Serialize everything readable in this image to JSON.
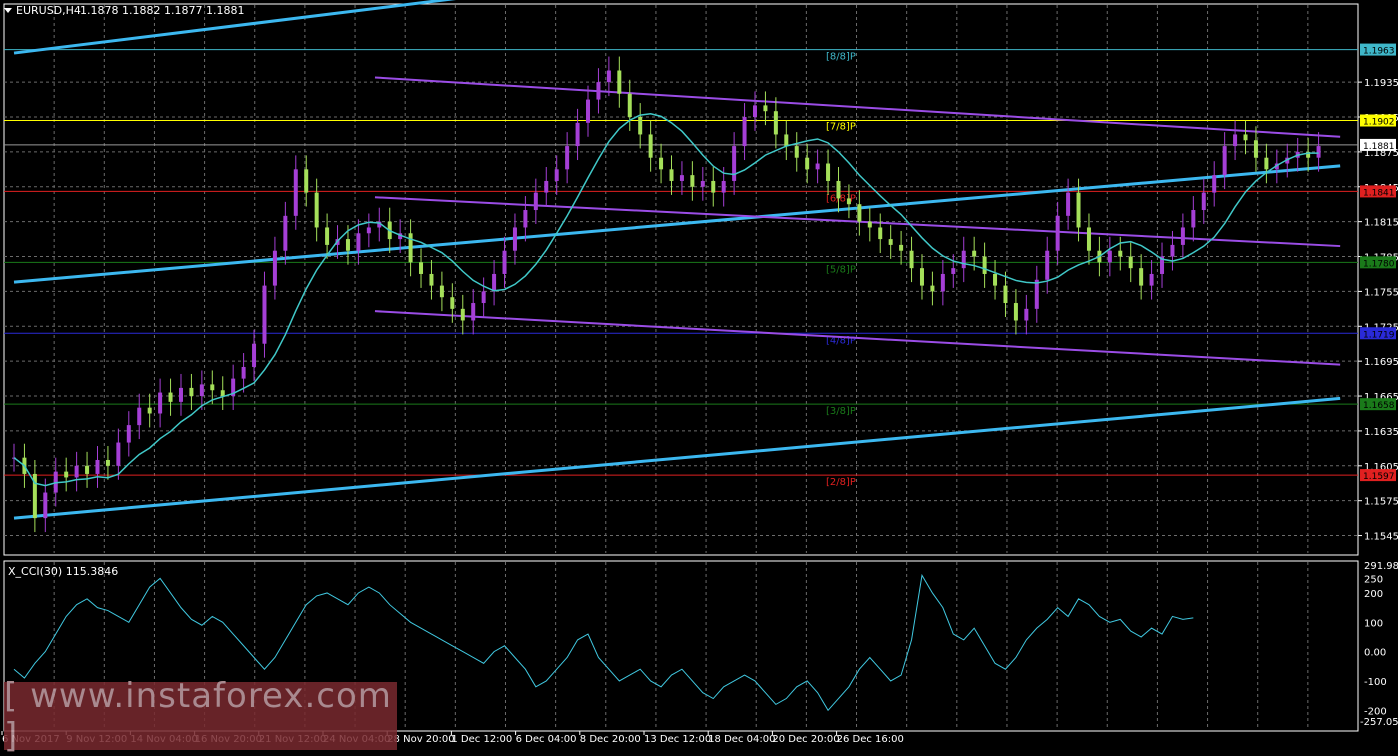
{
  "header": {
    "symbol": "EURUSD,H4",
    "ohlc": "1.1878 1.1882 1.1877 1.1881"
  },
  "indicator": {
    "label": "X_CCI(30) 115.3846",
    "max_label": "291.98",
    "min_label": "-257.052",
    "ticks": [
      "250",
      "200",
      "100",
      "0.00",
      "-100",
      "-200"
    ]
  },
  "watermark": "[ www.instaforex.com ]",
  "chart_data": {
    "type": "candlestick",
    "ylim": [
      1.153,
      1.1985
    ],
    "y_ticks": [
      1.1935,
      1.1905,
      1.1875,
      1.1845,
      1.1815,
      1.1785,
      1.1755,
      1.1725,
      1.1695,
      1.1665,
      1.1635,
      1.1605,
      1.1575,
      1.1545
    ],
    "x_tick_labels": [
      "6 Nov 2017",
      "9 Nov 12:00",
      "14 Nov 04:00",
      "16 Nov 20:00",
      "21 Nov 12:00",
      "24 Nov 04:00",
      "28 Nov 20:00",
      "1 Dec 12:00",
      "6 Dec 04:00",
      "8 Dec 20:00",
      "13 Dec 12:00",
      "18 Dec 04:00",
      "20 Dec 20:00",
      "26 Dec 16:00"
    ],
    "current_price": 1.1881,
    "murray_levels": [
      {
        "label": "[8/8]P",
        "price": 1.1963,
        "price_label": "1.1963",
        "color": "#3fb7c9"
      },
      {
        "label": "[7/8]P",
        "price": 1.1902,
        "price_label": "1.1902",
        "color": "#ffff00"
      },
      {
        "label": "[6/8]P",
        "price": 1.1841,
        "price_label": "1.1841",
        "color": "#e02020"
      },
      {
        "label": "[5/8]P",
        "price": 1.178,
        "price_label": "1.1780",
        "color": "#1a7a1a"
      },
      {
        "label": "[4/8]P",
        "price": 1.1719,
        "price_label": "1.1719",
        "color": "#2a2ad8"
      },
      {
        "label": "[3/8]P",
        "price": 1.1658,
        "price_label": "1.1658",
        "color": "#1a7a1a"
      },
      {
        "label": "[2/8]P",
        "price": 1.1597,
        "price_label": "1.1597",
        "color": "#e02020"
      }
    ],
    "candles": [
      1.1612,
      1.1598,
      1.156,
      1.1582,
      1.16,
      1.1595,
      1.1605,
      1.1598,
      1.161,
      1.1605,
      1.1625,
      1.164,
      1.1655,
      1.165,
      1.1668,
      1.166,
      1.1672,
      1.1665,
      1.1675,
      1.167,
      1.1665,
      1.168,
      1.169,
      1.171,
      1.176,
      1.179,
      1.182,
      1.186,
      1.184,
      1.181,
      1.1795,
      1.18,
      1.179,
      1.1805,
      1.181,
      1.1815,
      1.18,
      1.1805,
      1.178,
      1.177,
      1.176,
      1.175,
      1.174,
      1.173,
      1.1745,
      1.1755,
      1.177,
      1.179,
      1.181,
      1.1825,
      1.184,
      1.185,
      1.186,
      1.188,
      1.19,
      1.192,
      1.1935,
      1.1945,
      1.1925,
      1.1905,
      1.189,
      1.187,
      1.186,
      1.185,
      1.1855,
      1.1845,
      1.185,
      1.184,
      1.185,
      1.188,
      1.1905,
      1.1915,
      1.191,
      1.189,
      1.188,
      1.187,
      1.186,
      1.1865,
      1.185,
      1.1835,
      1.183,
      1.1815,
      1.181,
      1.18,
      1.1795,
      1.179,
      1.1775,
      1.176,
      1.1755,
      1.177,
      1.1775,
      1.179,
      1.1785,
      1.177,
      1.176,
      1.1745,
      1.173,
      1.174,
      1.1765,
      1.179,
      1.182,
      1.184,
      1.181,
      1.179,
      1.178,
      1.179,
      1.1785,
      1.1775,
      1.176,
      1.177,
      1.1785,
      1.1795,
      1.181,
      1.1825,
      1.184,
      1.1855,
      1.188,
      1.189,
      1.1885,
      1.187,
      1.186,
      1.1865,
      1.187,
      1.1875,
      1.187,
      1.188
    ],
    "series": [
      {
        "name": "",
        "type": "cci",
        "ylim": [
          -257.052,
          291.98
        ],
        "values": [
          -60,
          -90,
          -40,
          0,
          60,
          120,
          160,
          180,
          150,
          140,
          120,
          100,
          160,
          220,
          250,
          200,
          150,
          110,
          90,
          120,
          100,
          60,
          20,
          -20,
          -60,
          -20,
          40,
          100,
          160,
          190,
          200,
          180,
          160,
          200,
          220,
          200,
          160,
          130,
          100,
          80,
          60,
          40,
          20,
          0,
          -20,
          -40,
          0,
          20,
          -20,
          -60,
          -120,
          -100,
          -60,
          -20,
          40,
          60,
          -20,
          -60,
          -100,
          -80,
          -60,
          -100,
          -120,
          -80,
          -60,
          -100,
          -140,
          -160,
          -120,
          -100,
          -80,
          -100,
          -140,
          -180,
          -160,
          -120,
          -100,
          -140,
          -200,
          -160,
          -120,
          -60,
          -20,
          -60,
          -100,
          -80,
          40,
          260,
          200,
          150,
          60,
          40,
          80,
          20,
          -40,
          -60,
          -20,
          40,
          80,
          110,
          150,
          120,
          180,
          160,
          120,
          100,
          110,
          70,
          50,
          80,
          60,
          120,
          110,
          115
        ]
      }
    ],
    "trend_lines": [
      {
        "name": "blue-upper",
        "points": [
          [
            0,
            1.196
          ],
          [
            60,
            1.201
          ]
        ]
      },
      {
        "name": "blue-middle",
        "points": [
          [
            0,
            1.1763
          ],
          [
            169,
            1.1863
          ]
        ]
      },
      {
        "name": "blue-lower",
        "points": [
          [
            0,
            1.156
          ],
          [
            169,
            1.1663
          ]
        ]
      },
      {
        "name": "purple-top",
        "points": [
          [
            46,
            1.1939
          ],
          [
            169,
            1.1888
          ]
        ]
      },
      {
        "name": "purple-mid",
        "points": [
          [
            46,
            1.1836
          ],
          [
            169,
            1.1794
          ]
        ]
      },
      {
        "name": "purple-bottom",
        "points": [
          [
            46,
            1.1738
          ],
          [
            169,
            1.1692
          ]
        ]
      }
    ]
  }
}
